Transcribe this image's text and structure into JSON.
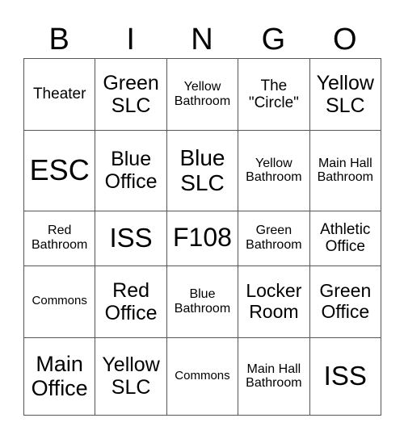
{
  "header": [
    "B",
    "I",
    "N",
    "G",
    "O"
  ],
  "cells": [
    [
      "Theater",
      "Green SLC",
      "Yellow Bathroom",
      "The \"Circle\"",
      "Yellow SLC"
    ],
    [
      "ESC",
      "Blue Office",
      "Blue SLC",
      "Yellow Bathroom",
      "Main Hall Bathroom"
    ],
    [
      "Red Bathroom",
      "ISS",
      "F108",
      "Green Bathroom",
      "Athletic Office"
    ],
    [
      "Commons",
      "Red Office",
      "Blue Bathroom",
      "Locker Room",
      "Green Office"
    ],
    [
      "Main Office",
      "Yellow SLC",
      "Commons",
      "Main Hall Bathroom",
      "ISS"
    ]
  ]
}
